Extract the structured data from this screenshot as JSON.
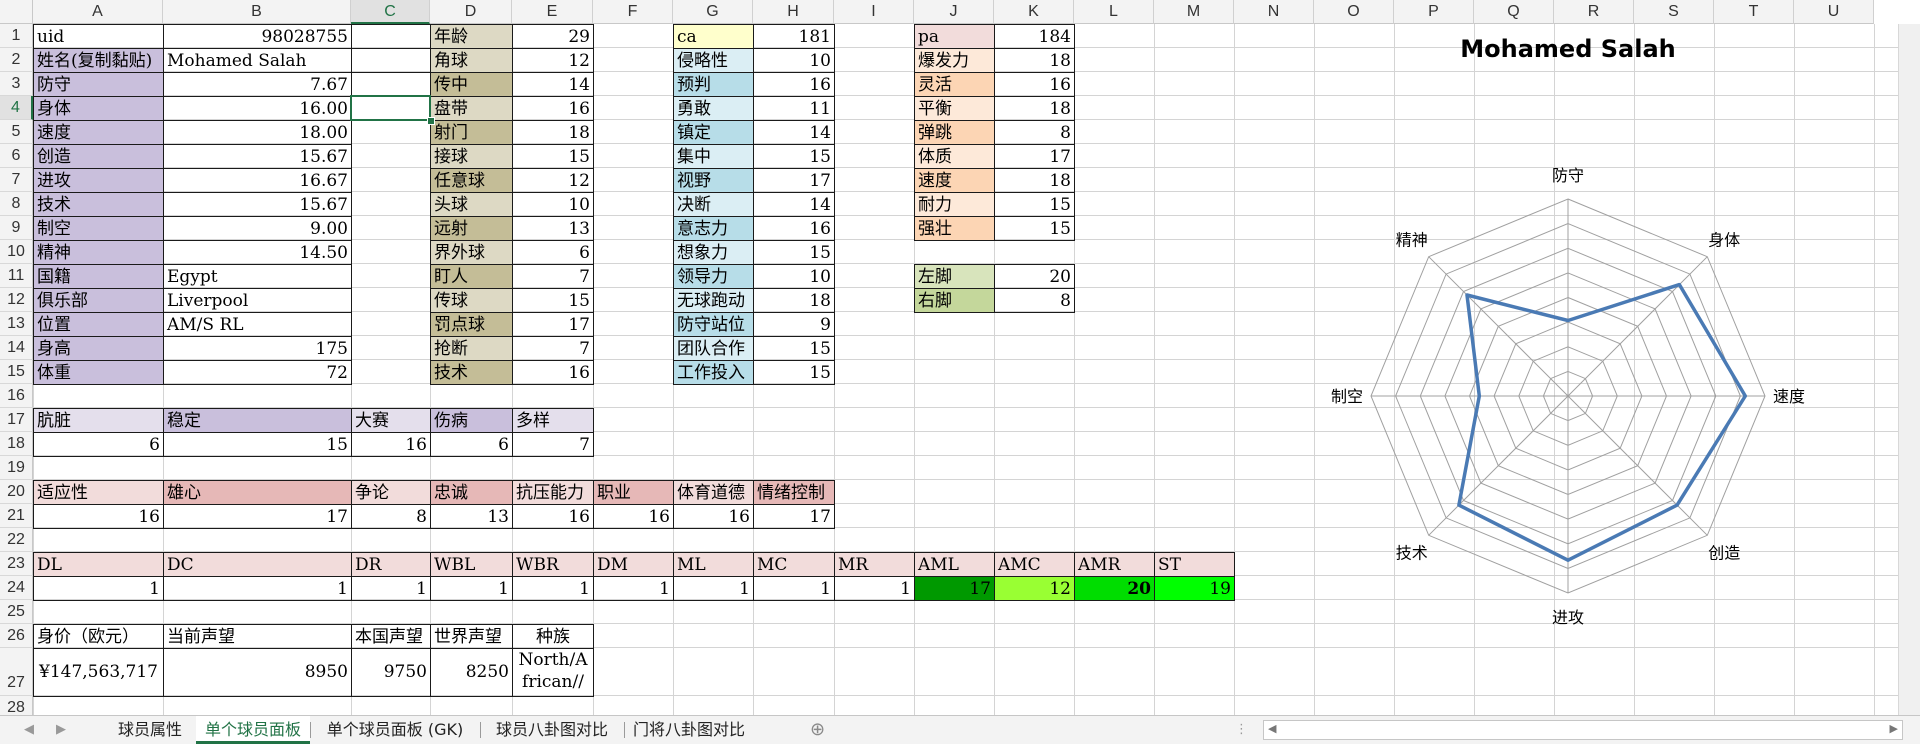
{
  "column_headers": [
    "A",
    "B",
    "C",
    "D",
    "E",
    "F",
    "G",
    "H",
    "I",
    "J",
    "K",
    "L",
    "M",
    "N",
    "O",
    "P",
    "Q",
    "R",
    "S",
    "T",
    "U"
  ],
  "row_numbers": [
    "1",
    "2",
    "3",
    "4",
    "5",
    "6",
    "7",
    "8",
    "9",
    "10",
    "11",
    "12",
    "13",
    "14",
    "15",
    "16",
    "17",
    "18",
    "19",
    "20",
    "21",
    "22",
    "23",
    "24",
    "25",
    "26",
    "27",
    "28"
  ],
  "player": {
    "uid_label": "uid",
    "uid": "98028755",
    "name_label": "姓名(复制黏贴)",
    "name": "Mohamed Salah",
    "categories": [
      {
        "label": "防守",
        "value": "7.67"
      },
      {
        "label": "身体",
        "value": "16.00"
      },
      {
        "label": "速度",
        "value": "18.00"
      },
      {
        "label": "创造",
        "value": "15.67"
      },
      {
        "label": "进攻",
        "value": "16.67"
      },
      {
        "label": "技术",
        "value": "15.67"
      },
      {
        "label": "制空",
        "value": "9.00"
      },
      {
        "label": "精神",
        "value": "14.50"
      }
    ],
    "nationality_label": "国籍",
    "nationality": "Egypt",
    "club_label": "俱乐部",
    "club": "Liverpool",
    "position_label": "位置",
    "position": "AM/S RL",
    "height_label": "身高",
    "height": "175",
    "weight_label": "体重",
    "weight": "72"
  },
  "technical": [
    {
      "label": "年龄",
      "value": "29"
    },
    {
      "label": "角球",
      "value": "12"
    },
    {
      "label": "传中",
      "value": "14"
    },
    {
      "label": "盘带",
      "value": "16"
    },
    {
      "label": "射门",
      "value": "18"
    },
    {
      "label": "接球",
      "value": "15"
    },
    {
      "label": "任意球",
      "value": "12"
    },
    {
      "label": "头球",
      "value": "10"
    },
    {
      "label": "远射",
      "value": "13"
    },
    {
      "label": "界外球",
      "value": "6"
    },
    {
      "label": "盯人",
      "value": "7"
    },
    {
      "label": "传球",
      "value": "15"
    },
    {
      "label": "罚点球",
      "value": "17"
    },
    {
      "label": "抢断",
      "value": "7"
    },
    {
      "label": "技术",
      "value": "16"
    }
  ],
  "mental": [
    {
      "label": "ca",
      "value": "181"
    },
    {
      "label": "侵略性",
      "value": "10"
    },
    {
      "label": "预判",
      "value": "16"
    },
    {
      "label": "勇敢",
      "value": "11"
    },
    {
      "label": "镇定",
      "value": "14"
    },
    {
      "label": "集中",
      "value": "15"
    },
    {
      "label": "视野",
      "value": "17"
    },
    {
      "label": "决断",
      "value": "14"
    },
    {
      "label": "意志力",
      "value": "16"
    },
    {
      "label": "想象力",
      "value": "15"
    },
    {
      "label": "领导力",
      "value": "10"
    },
    {
      "label": "无球跑动",
      "value": "18"
    },
    {
      "label": "防守站位",
      "value": "9"
    },
    {
      "label": "团队合作",
      "value": "15"
    },
    {
      "label": "工作投入",
      "value": "15"
    }
  ],
  "physical": [
    {
      "label": "pa",
      "value": "184"
    },
    {
      "label": "爆发力",
      "value": "18"
    },
    {
      "label": "灵活",
      "value": "16"
    },
    {
      "label": "平衡",
      "value": "18"
    },
    {
      "label": "弹跳",
      "value": "8"
    },
    {
      "label": "体质",
      "value": "17"
    },
    {
      "label": "速度",
      "value": "18"
    },
    {
      "label": "耐力",
      "value": "15"
    },
    {
      "label": "强壮",
      "value": "15"
    }
  ],
  "feet": [
    {
      "label": "左脚",
      "value": "20"
    },
    {
      "label": "右脚",
      "value": "8"
    }
  ],
  "hidden1": {
    "labels": [
      "肮脏",
      "稳定",
      "大赛",
      "伤病",
      "多样"
    ],
    "values": [
      "6",
      "15",
      "16",
      "6",
      "7"
    ]
  },
  "hidden2": {
    "labels": [
      "适应性",
      "雄心",
      "争论",
      "忠诚",
      "抗压能力",
      "职业",
      "体育道德",
      "情绪控制"
    ],
    "values": [
      "16",
      "17",
      "8",
      "13",
      "16",
      "16",
      "16",
      "17"
    ]
  },
  "positions": {
    "labels": [
      "DL",
      "DC",
      "DR",
      "WBL",
      "WBR",
      "DM",
      "ML",
      "MC",
      "MR",
      "AML",
      "AMC",
      "AMR",
      "ST"
    ],
    "values": [
      "1",
      "1",
      "1",
      "1",
      "1",
      "1",
      "1",
      "1",
      "1",
      "17",
      "12",
      "20",
      "19"
    ]
  },
  "finance": {
    "labels": [
      "身价（欧元）",
      "当前声望",
      "本国声望",
      "世界声望",
      "种族"
    ],
    "values": [
      "¥147,563,717",
      "8950",
      "9750",
      "8250",
      "North/African//Middle/Eastern"
    ]
  },
  "chart_data": {
    "type": "radar",
    "title": "Mohamed Salah",
    "axes": [
      "防守",
      "身体",
      "速度",
      "创造",
      "进攻",
      "技术",
      "制空",
      "精神"
    ],
    "values": [
      7.67,
      16.0,
      18.0,
      15.67,
      16.67,
      15.67,
      9.0,
      14.5
    ],
    "rmin": 0,
    "rmax": 20,
    "grid_step": 2.5,
    "series_color": "#4a7ab4",
    "grid_color": "#a0a0a0"
  },
  "tabs": [
    "球员属性",
    "单个球员面板",
    "单个球员面板 (GK)",
    "球员八卦图对比",
    "门将八卦图对比"
  ],
  "active_tab": 1,
  "colors": {
    "purple_label": "#c9bfdc",
    "tan_label": "#c4bd97",
    "tan_light": "#ddd9c4",
    "blue_label": "#b7dde8",
    "blue_light": "#dbeef4",
    "yellow_label": "#ffffcc",
    "orange_label": "#fcd5b4",
    "orange_light": "#fde9d9",
    "pink_label": "#f2dcdb",
    "pink_dark": "#e6b8b7",
    "lavender_light": "#e4dfec",
    "green_label": "#d8e4bc",
    "green_dark": "#c4d79b",
    "pos_17": "#009900",
    "pos_12": "#99ff33",
    "pos_20": "#00dd00",
    "pos_19": "#00ff00"
  }
}
